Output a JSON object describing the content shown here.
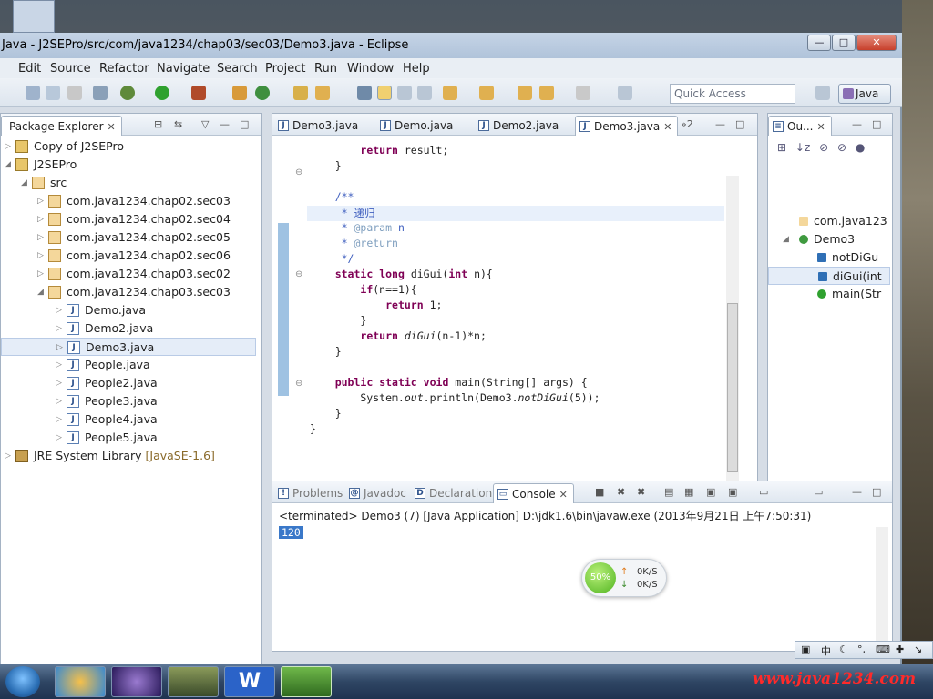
{
  "window": {
    "title": "Java - J2SEPro/src/com/java1234/chap03/sec03/Demo3.java - Eclipse"
  },
  "menu": [
    "Edit",
    "Source",
    "Refactor",
    "Navigate",
    "Search",
    "Project",
    "Run",
    "Window",
    "Help"
  ],
  "toolbar": {
    "quick_access_placeholder": "Quick Access",
    "perspective": "Java"
  },
  "package_explorer": {
    "title": "Package Explorer",
    "items": [
      {
        "label": "Copy of J2SEPro",
        "level": 0,
        "kind": "project",
        "expanded": false
      },
      {
        "label": "J2SEPro",
        "level": 0,
        "kind": "project",
        "expanded": true
      },
      {
        "label": "src",
        "level": 1,
        "kind": "src",
        "expanded": true
      },
      {
        "label": "com.java1234.chap02.sec03",
        "level": 2,
        "kind": "package",
        "expanded": false
      },
      {
        "label": "com.java1234.chap02.sec04",
        "level": 2,
        "kind": "package",
        "expanded": false
      },
      {
        "label": "com.java1234.chap02.sec05",
        "level": 2,
        "kind": "package",
        "expanded": false
      },
      {
        "label": "com.java1234.chap02.sec06",
        "level": 2,
        "kind": "package",
        "expanded": false
      },
      {
        "label": "com.java1234.chap03.sec02",
        "level": 2,
        "kind": "package",
        "expanded": false
      },
      {
        "label": "com.java1234.chap03.sec03",
        "level": 2,
        "kind": "package",
        "expanded": true
      },
      {
        "label": "Demo.java",
        "level": 3,
        "kind": "java"
      },
      {
        "label": "Demo2.java",
        "level": 3,
        "kind": "java"
      },
      {
        "label": "Demo3.java",
        "level": 3,
        "kind": "java",
        "selected": true
      },
      {
        "label": "People.java",
        "level": 3,
        "kind": "java"
      },
      {
        "label": "People2.java",
        "level": 3,
        "kind": "java"
      },
      {
        "label": "People3.java",
        "level": 3,
        "kind": "java"
      },
      {
        "label": "People4.java",
        "level": 3,
        "kind": "java"
      },
      {
        "label": "People5.java",
        "level": 3,
        "kind": "java"
      },
      {
        "label": "JRE System Library",
        "level": 0,
        "kind": "library",
        "suffix": "[JavaSE-1.6]"
      }
    ]
  },
  "editor": {
    "tabs": [
      {
        "label": "Demo3.java",
        "active": false
      },
      {
        "label": "Demo.java",
        "active": false
      },
      {
        "label": "Demo2.java",
        "active": false
      },
      {
        "label": "Demo3.java",
        "active": true
      }
    ],
    "overflow": "»2",
    "code": [
      {
        "tokens": [
          {
            "t": "        "
          },
          {
            "t": "return",
            "c": "kw"
          },
          {
            "t": " result;"
          }
        ]
      },
      {
        "tokens": [
          {
            "t": "    }"
          }
        ]
      },
      {
        "tokens": [
          {
            "t": ""
          }
        ]
      },
      {
        "tokens": [
          {
            "t": "    "
          },
          {
            "t": "/**",
            "c": "cm"
          }
        ]
      },
      {
        "tokens": [
          {
            "t": "     "
          },
          {
            "t": "* 递归",
            "c": "cm"
          }
        ]
      },
      {
        "tokens": [
          {
            "t": "     "
          },
          {
            "t": "* ",
            "c": "cm"
          },
          {
            "t": "@param",
            "c": "ann"
          },
          {
            "t": " n",
            "c": "cm"
          }
        ]
      },
      {
        "tokens": [
          {
            "t": "     "
          },
          {
            "t": "* ",
            "c": "cm"
          },
          {
            "t": "@return",
            "c": "ann"
          }
        ]
      },
      {
        "tokens": [
          {
            "t": "     "
          },
          {
            "t": "*/",
            "c": "cm"
          }
        ]
      },
      {
        "tokens": [
          {
            "t": "    "
          },
          {
            "t": "static",
            "c": "kw"
          },
          {
            "t": " "
          },
          {
            "t": "long",
            "c": "kw"
          },
          {
            "t": " diGui("
          },
          {
            "t": "int",
            "c": "kw"
          },
          {
            "t": " n){"
          }
        ]
      },
      {
        "tokens": [
          {
            "t": "        "
          },
          {
            "t": "if",
            "c": "kw"
          },
          {
            "t": "(n==1){"
          }
        ]
      },
      {
        "tokens": [
          {
            "t": "            "
          },
          {
            "t": "return",
            "c": "kw"
          },
          {
            "t": " 1;"
          }
        ]
      },
      {
        "tokens": [
          {
            "t": "        }"
          }
        ]
      },
      {
        "tokens": [
          {
            "t": "        "
          },
          {
            "t": "return",
            "c": "kw"
          },
          {
            "t": " "
          },
          {
            "t": "diGui",
            "c": "it"
          },
          {
            "t": "(n-1)*n;"
          }
        ]
      },
      {
        "tokens": [
          {
            "t": "    }"
          }
        ]
      },
      {
        "tokens": [
          {
            "t": ""
          }
        ]
      },
      {
        "tokens": [
          {
            "t": "    "
          },
          {
            "t": "public",
            "c": "kw"
          },
          {
            "t": " "
          },
          {
            "t": "static",
            "c": "kw"
          },
          {
            "t": " "
          },
          {
            "t": "void",
            "c": "kw"
          },
          {
            "t": " main(String[] args) {"
          }
        ]
      },
      {
        "tokens": [
          {
            "t": "        System."
          },
          {
            "t": "out",
            "c": "it"
          },
          {
            "t": ".println(Demo3."
          },
          {
            "t": "notDiGui",
            "c": "it"
          },
          {
            "t": "(5));"
          }
        ]
      },
      {
        "tokens": [
          {
            "t": "    }"
          }
        ]
      },
      {
        "tokens": [
          {
            "t": "}"
          }
        ]
      }
    ]
  },
  "outline": {
    "title": "Ou...",
    "items": [
      {
        "label": "com.java123",
        "level": 0,
        "kind": "package"
      },
      {
        "label": "Demo3",
        "level": 0,
        "kind": "class"
      },
      {
        "label": "notDiGu",
        "level": 1,
        "kind": "method-s"
      },
      {
        "label": "diGui(int",
        "level": 1,
        "kind": "method-s",
        "selected": true
      },
      {
        "label": "main(Str",
        "level": 1,
        "kind": "method-p"
      }
    ]
  },
  "bottom_tabs": [
    {
      "label": "Problems",
      "active": false
    },
    {
      "label": "Javadoc",
      "active": false
    },
    {
      "label": "Declaration",
      "active": false
    },
    {
      "label": "Console",
      "active": true
    }
  ],
  "console": {
    "status": "<terminated> Demo3 (7) [Java Application] D:\\jdk1.6\\bin\\javaw.exe (2013年9月21日 上午7:50:31)",
    "output": "120"
  },
  "gadget": {
    "percent": "50%",
    "up": "0K/S",
    "down": "0K/S"
  },
  "ime": {
    "lang": "中"
  },
  "watermark": "www.java1234.com",
  "colors": {
    "keyword": "#7f0055",
    "comment": "#3f5fbf",
    "watermark": "#ff2a2a"
  }
}
